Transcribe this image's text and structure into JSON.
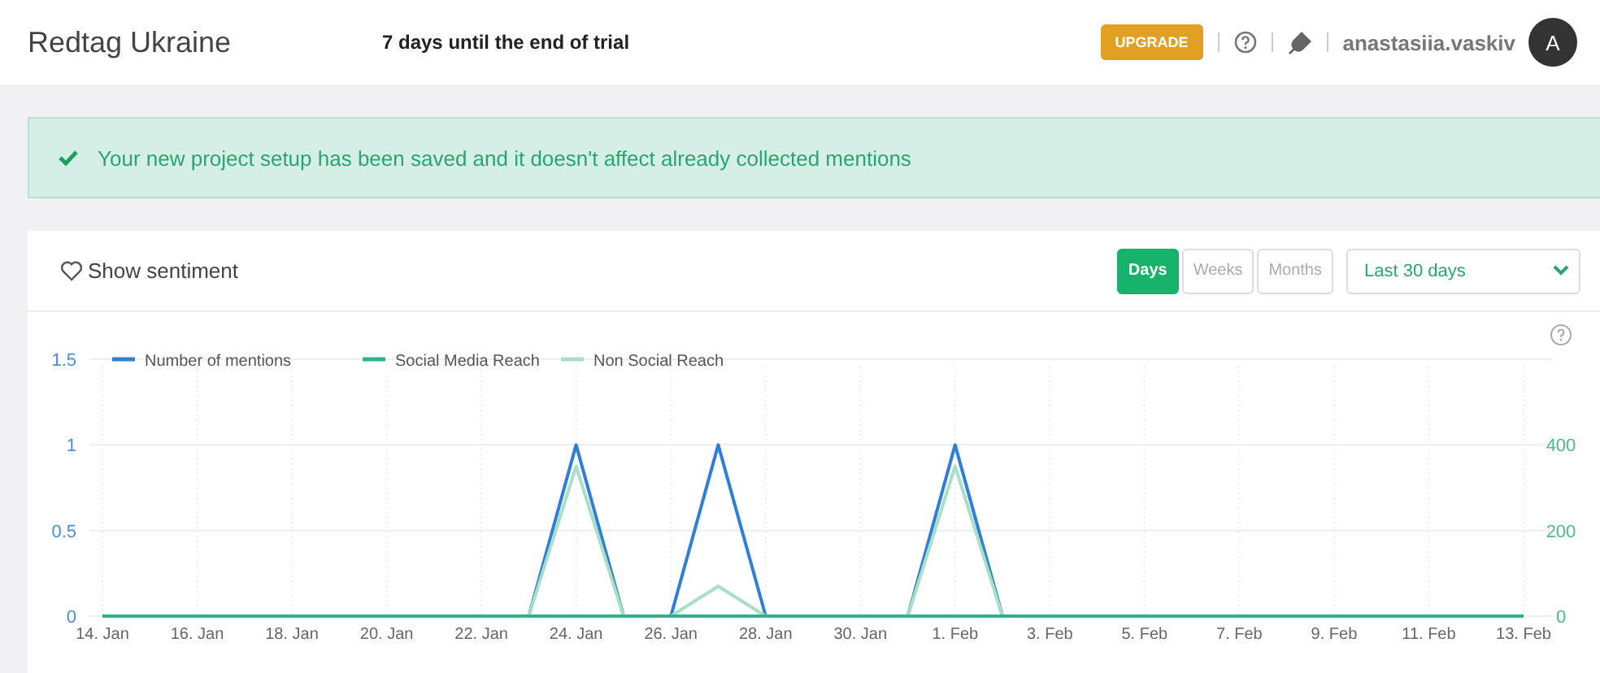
{
  "header": {
    "project": "Redtag Ukraine",
    "trial": "7 days until the end of trial",
    "upgrade": "UPGRADE",
    "user": "anastasiia.vaskiv",
    "avatar": "A"
  },
  "alert": {
    "text": "Your new project setup has been saved and it doesn't affect already collected mentions"
  },
  "toolbar": {
    "sentiment": "Show sentiment",
    "periods": [
      {
        "label": "Days",
        "selected": true
      },
      {
        "label": "Weeks",
        "selected": false
      },
      {
        "label": "Months",
        "selected": false
      }
    ],
    "range": "Last 30 days"
  },
  "chart": {
    "chart_data": {
      "type": "line",
      "categories": [
        "14. Jan",
        null,
        "16. Jan",
        null,
        "18. Jan",
        null,
        "20. Jan",
        null,
        "22. Jan",
        null,
        "24. Jan",
        null,
        "26. Jan",
        null,
        "28. Jan",
        null,
        "30. Jan",
        null,
        "1. Feb",
        null,
        "3. Feb",
        null,
        "5. Feb",
        null,
        "7. Feb",
        null,
        "9. Feb",
        null,
        "11. Feb",
        null,
        "13. Feb"
      ],
      "grid": true,
      "legend": true,
      "ylim": [
        0,
        1.5
      ],
      "yticks": [
        0,
        0.5,
        1,
        1.5
      ],
      "y2lim": [
        0,
        600
      ],
      "y2ticks": [
        0,
        200,
        400
      ],
      "series": [
        {
          "name": "Number of mentions",
          "color": "#2f7ed8",
          "values": [
            null,
            null,
            null,
            null,
            null,
            null,
            null,
            null,
            null,
            0,
            1,
            0,
            0,
            1,
            0,
            null,
            null,
            0,
            1,
            0,
            null,
            null,
            null,
            null,
            null,
            null,
            null,
            null,
            null,
            null,
            null
          ]
        },
        {
          "name": "Social Media Reach",
          "color": "#2bb48a",
          "axis": "y2",
          "values": [
            0,
            0,
            0,
            0,
            0,
            0,
            0,
            0,
            0,
            0,
            0,
            0,
            0,
            0,
            0,
            0,
            0,
            0,
            0,
            0,
            0,
            0,
            0,
            0,
            0,
            0,
            0,
            0,
            0,
            0,
            0
          ]
        },
        {
          "name": "Non Social Reach",
          "color": "#a8e0c6",
          "axis": "y2",
          "values": [
            null,
            null,
            null,
            null,
            null,
            null,
            null,
            null,
            null,
            0,
            350,
            0,
            0,
            70,
            0,
            null,
            null,
            0,
            350,
            0,
            null,
            null,
            null,
            null,
            null,
            null,
            null,
            null,
            null,
            null,
            null
          ]
        }
      ]
    }
  }
}
